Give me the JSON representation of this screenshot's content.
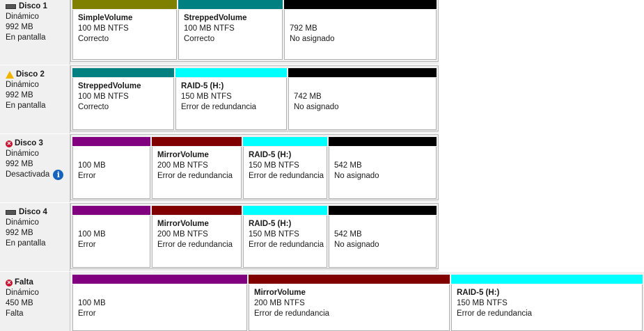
{
  "colors": {
    "simple": "#808000",
    "striped": "#008080",
    "raid5": "#00ffff",
    "mirror": "#800000",
    "spanned": "#800080",
    "unallocated": "#000000"
  },
  "disks": [
    {
      "name": "Disco 1",
      "icon": "drive-icon",
      "type": "Dinámico",
      "size": "992 MB",
      "status": "En pantalla",
      "partitions": [
        {
          "name": "SimpleVolume",
          "size": "100 MB NTFS",
          "status": "Correcto",
          "color": "#808000"
        },
        {
          "name": "StreppedVolume",
          "size": "100 MB NTFS",
          "status": "Correcto",
          "color": "#008080"
        },
        {
          "name": "",
          "size": "792 MB",
          "status": "No asignado",
          "color": "#000000"
        }
      ]
    },
    {
      "name": "Disco 2",
      "icon": "warning-drive-icon",
      "type": "Dinámico",
      "size": "992 MB",
      "status": "En pantalla",
      "partitions": [
        {
          "name": "StreppedVolume",
          "size": "100 MB NTFS",
          "status": "Correcto",
          "color": "#008080"
        },
        {
          "name": "RAID-5  (H:)",
          "size": "150 MB NTFS",
          "status": "Error de redundancia",
          "color": "#00ffff"
        },
        {
          "name": "",
          "size": "742 MB",
          "status": "No asignado",
          "color": "#000000"
        }
      ]
    },
    {
      "name": "Disco 3",
      "icon": "error-drive-icon",
      "type": "Dinámico",
      "size": "992 MB",
      "status": "Desactivada",
      "partitions": [
        {
          "name": "",
          "size": "100 MB",
          "status": "Error",
          "color": "#800080"
        },
        {
          "name": "MirrorVolume",
          "size": "200 MB NTFS",
          "status": "Error de redundancia",
          "color": "#800000"
        },
        {
          "name": "RAID-5  (H:)",
          "size": "150 MB NTFS",
          "status": "Error de redundancia",
          "color": "#00ffff"
        },
        {
          "name": "",
          "size": "542 MB",
          "status": "No asignado",
          "color": "#000000"
        }
      ]
    },
    {
      "name": "Disco 4",
      "icon": "drive-icon",
      "type": "Dinámico",
      "size": "992 MB",
      "status": "En pantalla",
      "partitions": [
        {
          "name": "",
          "size": "100 MB",
          "status": "Error",
          "color": "#800080"
        },
        {
          "name": "MirrorVolume",
          "size": "200 MB NTFS",
          "status": "Error de redundancia",
          "color": "#800000"
        },
        {
          "name": "RAID-5  (H:)",
          "size": "150 MB NTFS",
          "status": "Error de redundancia",
          "color": "#00ffff"
        },
        {
          "name": "",
          "size": "542 MB",
          "status": "No asignado",
          "color": "#000000"
        }
      ]
    },
    {
      "name": "Falta",
      "icon": "error-drive-icon",
      "type": "Dinámico",
      "size": "450 MB",
      "status": "Falta",
      "partitions": [
        {
          "name": "",
          "size": "100 MB",
          "status": "Error",
          "color": "#800080"
        },
        {
          "name": "MirrorVolume",
          "size": "200 MB NTFS",
          "status": "Error de redundancia",
          "color": "#800000"
        },
        {
          "name": "RAID-5  (H:)",
          "size": "150 MB NTFS",
          "status": "Error de redundancia",
          "color": "#00ffff"
        }
      ]
    }
  ]
}
